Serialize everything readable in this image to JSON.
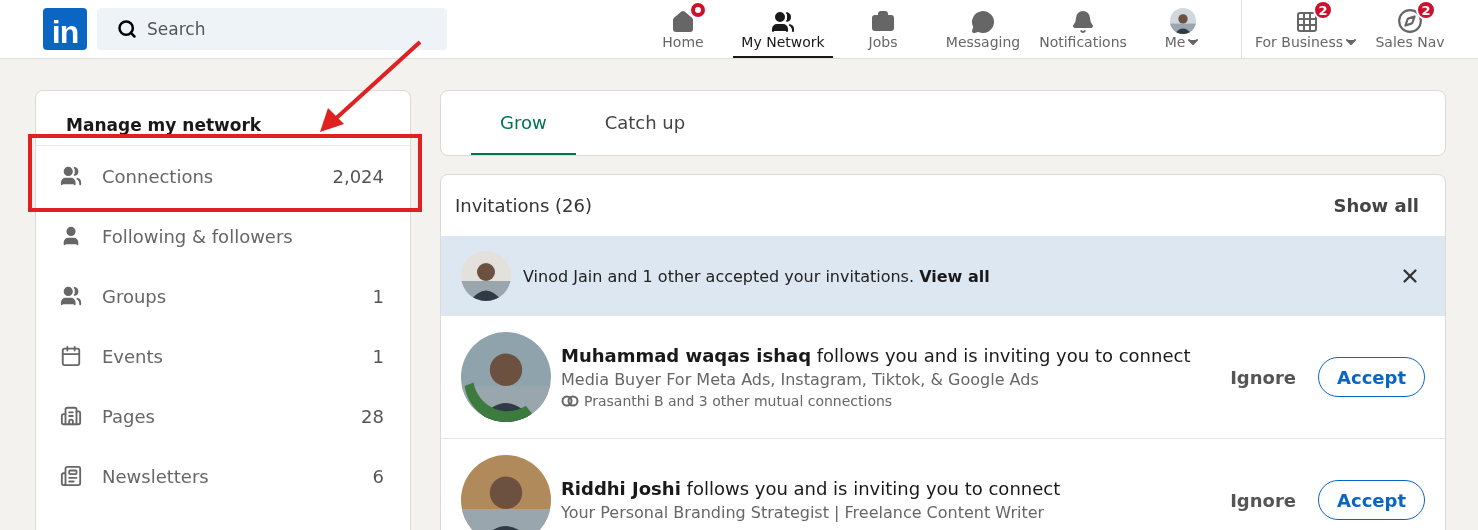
{
  "header": {
    "logo": "in",
    "search": {
      "placeholder": "Search"
    },
    "nav": [
      {
        "kind": "home",
        "label": "Home",
        "selected": false,
        "dot": true
      },
      {
        "kind": "network",
        "label": "My Network",
        "selected": true
      },
      {
        "kind": "jobs",
        "label": "Jobs",
        "selected": false
      },
      {
        "kind": "messaging",
        "label": "Messaging",
        "selected": false
      },
      {
        "kind": "notifications",
        "label": "Notifications",
        "selected": false
      },
      {
        "kind": "me",
        "label": "Me",
        "selected": false,
        "caret": true
      }
    ],
    "business": [
      {
        "kind": "grid",
        "label": "For Business",
        "badge": "2",
        "caret": true
      },
      {
        "kind": "compass",
        "label": "Sales Nav",
        "badge": "2"
      }
    ]
  },
  "sidebar": {
    "title": "Manage my network",
    "items": [
      {
        "kind": "connections",
        "label": "Connections",
        "count": "2,024",
        "highlighted": true
      },
      {
        "kind": "following",
        "label": "Following & followers",
        "highlighted": false
      },
      {
        "kind": "groups",
        "label": "Groups",
        "count": "1",
        "highlighted": false
      },
      {
        "kind": "events",
        "label": "Events",
        "count": "1",
        "highlighted": false
      },
      {
        "kind": "pages",
        "label": "Pages",
        "count": "28",
        "highlighted": false
      },
      {
        "kind": "newsletters",
        "label": "Newsletters",
        "count": "6",
        "highlighted": false
      }
    ]
  },
  "tabs": [
    {
      "label": "Grow",
      "selected": true
    },
    {
      "label": "Catch up",
      "selected": false
    }
  ],
  "invitations": {
    "title": "Invitations (26)",
    "show_all": "Show all",
    "banner": {
      "text": "Vinod Jain and 1 other accepted your invitations.",
      "link": "View all"
    },
    "rows": [
      {
        "name": "Muhammad waqas ishaq",
        "text": "follows you and is inviting you to connect",
        "headline": "Media Buyer For Meta Ads, Instagram, Tiktok, & Google Ads",
        "mutual": "Prasanthi B and 3 other mutual connections",
        "open_to_work": true,
        "ignore": "Ignore",
        "accept": "Accept"
      },
      {
        "name": "Riddhi Joshi",
        "text": "follows you and is inviting you to connect",
        "headline": "Your Personal Branding Strategist | Freelance Content Writer",
        "open_to_work": false,
        "ignore": "Ignore",
        "accept": "Accept"
      }
    ]
  }
}
